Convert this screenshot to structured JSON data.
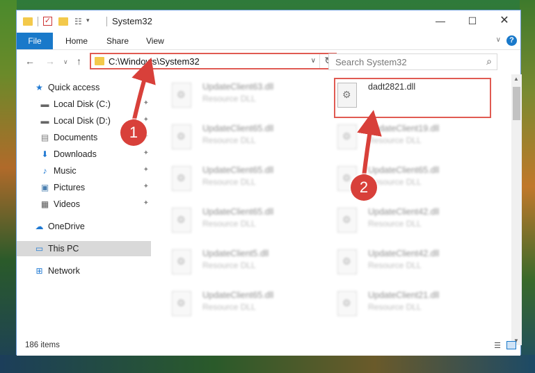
{
  "window": {
    "title": "System32",
    "caption": {
      "minimize": "—",
      "maximize": "☐",
      "close": "✕"
    }
  },
  "quick_access_toolbar": {
    "props_glyph": "☷",
    "dropdown_glyph": "▾",
    "check_glyph": "✓"
  },
  "ribbon": {
    "tabs": [
      "File",
      "Home",
      "Share",
      "View"
    ],
    "expand_glyph": "∨",
    "help_glyph": "?"
  },
  "navigation": {
    "back_glyph": "←",
    "forward_glyph": "→",
    "recent_glyph": "∨",
    "up_glyph": "↑",
    "address": "C:\\Windows\\System32",
    "address_drop_glyph": "∨",
    "refresh_glyph": "↻",
    "search_placeholder": "Search System32",
    "search_glyph": "⌕"
  },
  "sidebar": {
    "items": [
      {
        "label": "Quick access",
        "icon": "star-icon",
        "glyph": "★",
        "color": "#1e78d2"
      },
      {
        "label": "Local Disk (C:)",
        "icon": "drive-icon",
        "glyph": "▬",
        "color": "#666666",
        "pinned": true
      },
      {
        "label": "Local Disk (D:)",
        "icon": "drive-icon",
        "glyph": "▬",
        "color": "#666666",
        "pinned": true
      },
      {
        "label": "Documents",
        "icon": "documents-icon",
        "glyph": "▤",
        "color": "#7a7a7a",
        "pinned": true
      },
      {
        "label": "Downloads",
        "icon": "downloads-icon",
        "glyph": "⬇",
        "color": "#1e78d2",
        "pinned": true
      },
      {
        "label": "Music",
        "icon": "music-icon",
        "glyph": "♪",
        "color": "#1e78d2",
        "pinned": true
      },
      {
        "label": "Pictures",
        "icon": "pictures-icon",
        "glyph": "▣",
        "color": "#4a7fb0",
        "pinned": true
      },
      {
        "label": "Videos",
        "icon": "videos-icon",
        "glyph": "▦",
        "color": "#555555",
        "pinned": true
      },
      {
        "label": "OneDrive",
        "icon": "onedrive-icon",
        "glyph": "☁",
        "color": "#1e78d2"
      },
      {
        "label": "This PC",
        "icon": "monitor-icon",
        "glyph": "▭",
        "color": "#1e78d2",
        "selected": true
      },
      {
        "label": "Network",
        "icon": "network-icon",
        "glyph": "⊞",
        "color": "#1e78d2"
      }
    ],
    "pin_glyph": "📌"
  },
  "files": {
    "col1": [
      {
        "name": "UpdateClient63.dll",
        "type": "Resource DLL"
      },
      {
        "name": "UpdateClient65.dll",
        "type": "Resource DLL"
      },
      {
        "name": "UpdateClient65.dll",
        "type": "Resource DLL"
      },
      {
        "name": "UpdateClient65.dll",
        "type": "Resource DLL"
      },
      {
        "name": "UpdateClient5.dll",
        "type": "Resource DLL"
      },
      {
        "name": "UpdateClient65.dll",
        "type": "Resource DLL"
      }
    ],
    "col2": [
      {
        "name": "dadt2821.dll",
        "type": ""
      },
      {
        "name": "UpdateClient19.dll",
        "type": "Resource DLL"
      },
      {
        "name": "UpdateClient65.dll",
        "type": "Resource DLL"
      },
      {
        "name": "UpdateClient42.dll",
        "type": "Resource DLL"
      },
      {
        "name": "UpdateClient42.dll",
        "type": "Resource DLL"
      },
      {
        "name": "UpdateClient21.dll",
        "type": "Resource DLL"
      }
    ]
  },
  "status": {
    "item_count": "186 items",
    "details_glyph": "☰"
  },
  "annotations": {
    "badge1": "1",
    "badge2": "2",
    "color": "#d8403a"
  }
}
